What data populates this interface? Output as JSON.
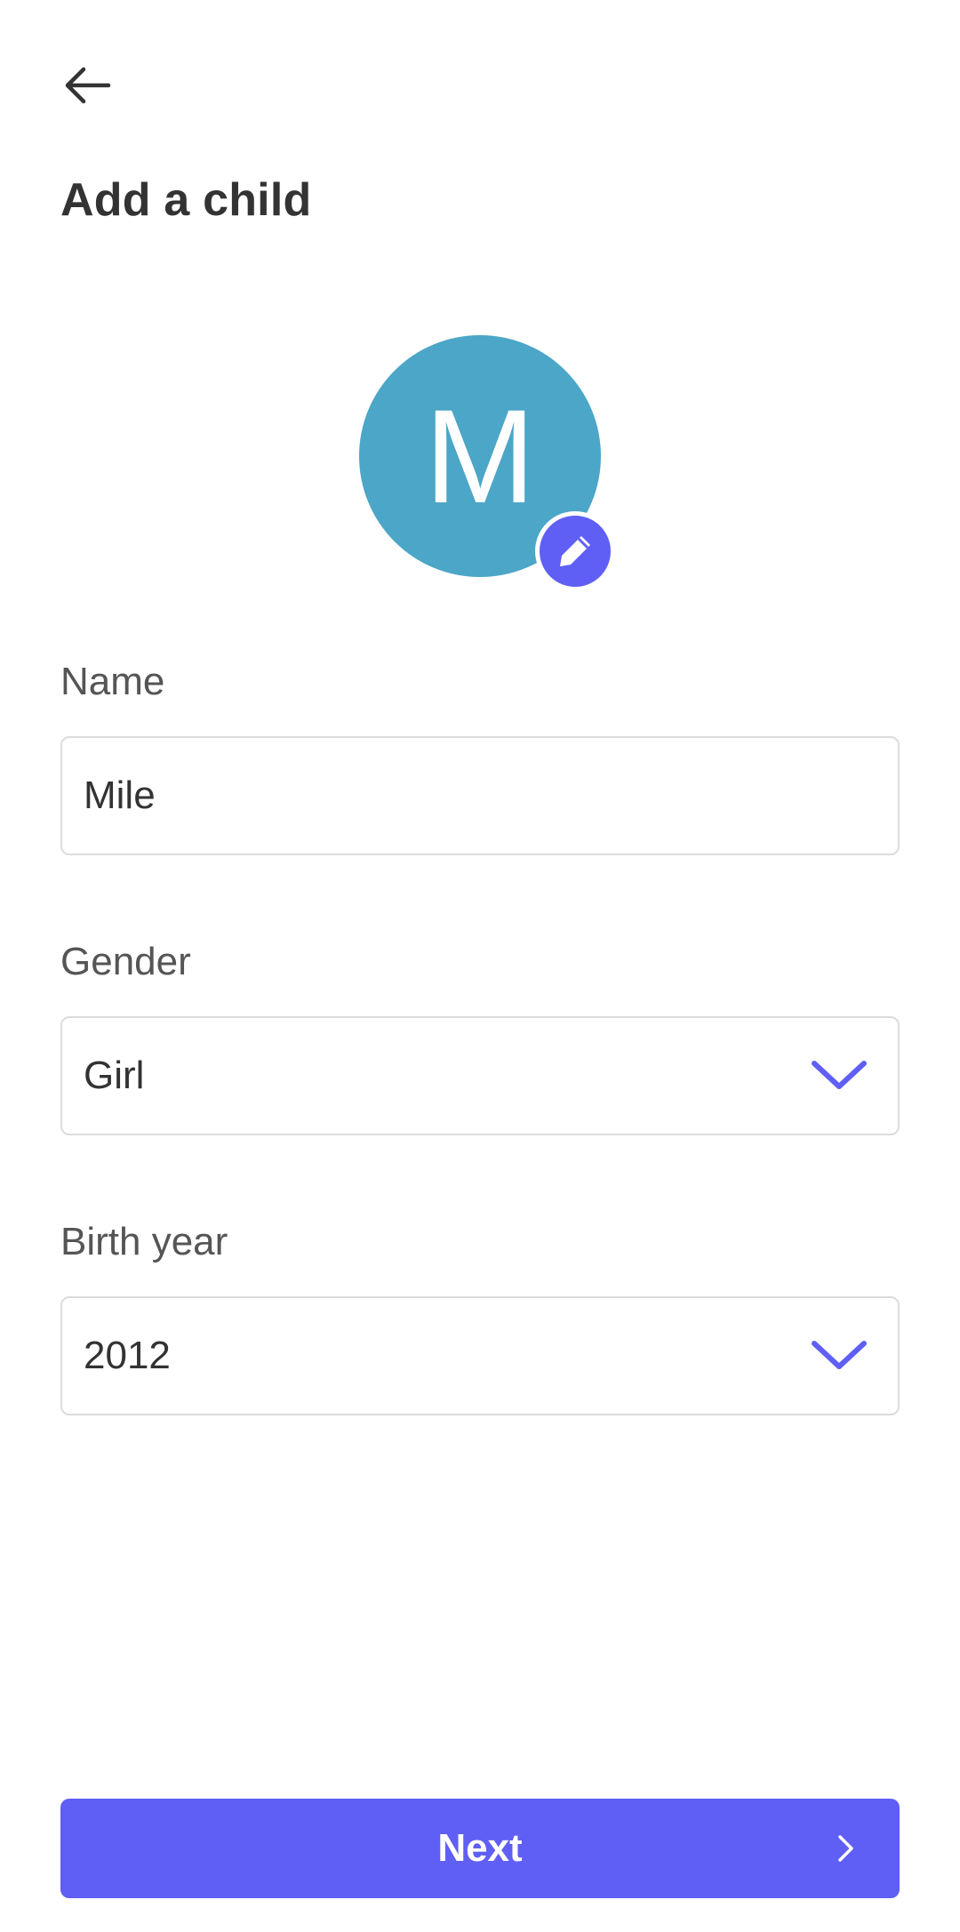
{
  "header": {
    "back_icon": "arrow-left-icon",
    "title": "Add a child"
  },
  "avatar": {
    "initial": "M",
    "color": "#4BA6C7",
    "edit_icon": "pencil-icon",
    "edit_color": "#5F5FF6"
  },
  "form": {
    "name": {
      "label": "Name",
      "value": "Mile"
    },
    "gender": {
      "label": "Gender",
      "value": "Girl",
      "icon": "chevron-down-icon"
    },
    "birth_year": {
      "label": "Birth year",
      "value": "2012",
      "icon": "chevron-down-icon"
    }
  },
  "footer": {
    "next_label": "Next",
    "next_icon": "chevron-right-icon",
    "accent": "#5F5FF6"
  }
}
